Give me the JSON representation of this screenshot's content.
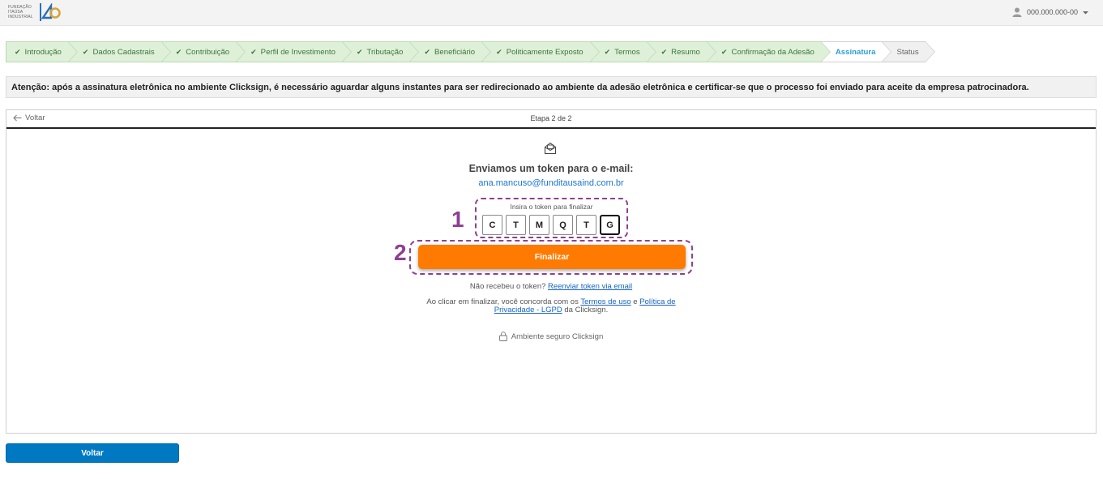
{
  "header": {
    "logo_text": [
      "FUNDAÇÃO",
      "ITAÚSA",
      "INDUSTRIAL"
    ],
    "user_id": "000.000.000-00"
  },
  "steps": [
    {
      "label": "Introdução",
      "state": "done"
    },
    {
      "label": "Dados Cadastrais",
      "state": "done"
    },
    {
      "label": "Contribuição",
      "state": "done"
    },
    {
      "label": "Perfil de Investimento",
      "state": "done"
    },
    {
      "label": "Tributação",
      "state": "done"
    },
    {
      "label": "Beneficiário",
      "state": "done"
    },
    {
      "label": "Politicamente Exposto",
      "state": "done"
    },
    {
      "label": "Termos",
      "state": "done"
    },
    {
      "label": "Resumo",
      "state": "done"
    },
    {
      "label": "Confirmação da Adesão",
      "state": "done"
    },
    {
      "label": "Assinatura",
      "state": "active"
    },
    {
      "label": "Status",
      "state": "pending"
    }
  ],
  "alert": {
    "text": "Atenção: após a assinatura eletrônica no ambiente Clicksign, é necessário aguardar alguns instantes para ser redirecionado ao ambiente da adesão eletrônica e certificar-se que o processo foi enviado para aceite da empresa patrocinadora."
  },
  "frame": {
    "back_label": "Voltar",
    "step_indicator": "Etapa 2 de 2"
  },
  "token": {
    "heading": "Enviamos um token para o e-mail:",
    "email": "ana.mancuso@funditausaind.com.br",
    "label": "Insira o token para finalizar",
    "cells": [
      "C",
      "T",
      "M",
      "Q",
      "T",
      "G"
    ]
  },
  "annotations": {
    "one": "1",
    "two": "2"
  },
  "actions": {
    "finalize_label": "Finalizar",
    "resend_prefix": "Não recebeu o token?",
    "resend_link": "Reenviar token via email",
    "terms_prefix": "Ao clicar em finalizar, você concorda com os",
    "terms_link": "Termos de uso",
    "terms_and": "e",
    "privacy_link": "Política de Privacidade - LGPD",
    "terms_suffix": "da Clicksign.",
    "secure_label": "Ambiente seguro Clicksign",
    "bottom_back_label": "Voltar"
  },
  "colors": {
    "accent_orange": "#ff7a00",
    "annotation_purple": "#8e3f93",
    "primary_blue": "#0079c2",
    "step_done_bg": "#dff0d8"
  }
}
